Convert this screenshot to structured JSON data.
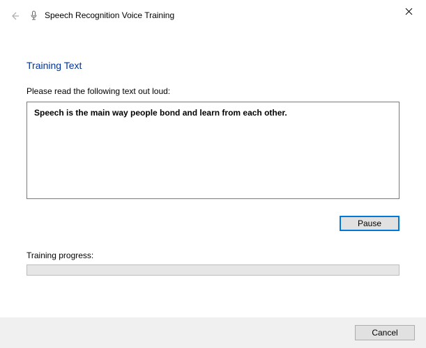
{
  "window": {
    "title": "Speech Recognition Voice Training"
  },
  "main": {
    "heading": "Training Text",
    "instruction": "Please read the following text out loud:",
    "training_text": "Speech is the main way people bond and learn from each other.",
    "pause_label": "Pause",
    "progress_label": "Training progress:"
  },
  "footer": {
    "cancel_label": "Cancel"
  }
}
